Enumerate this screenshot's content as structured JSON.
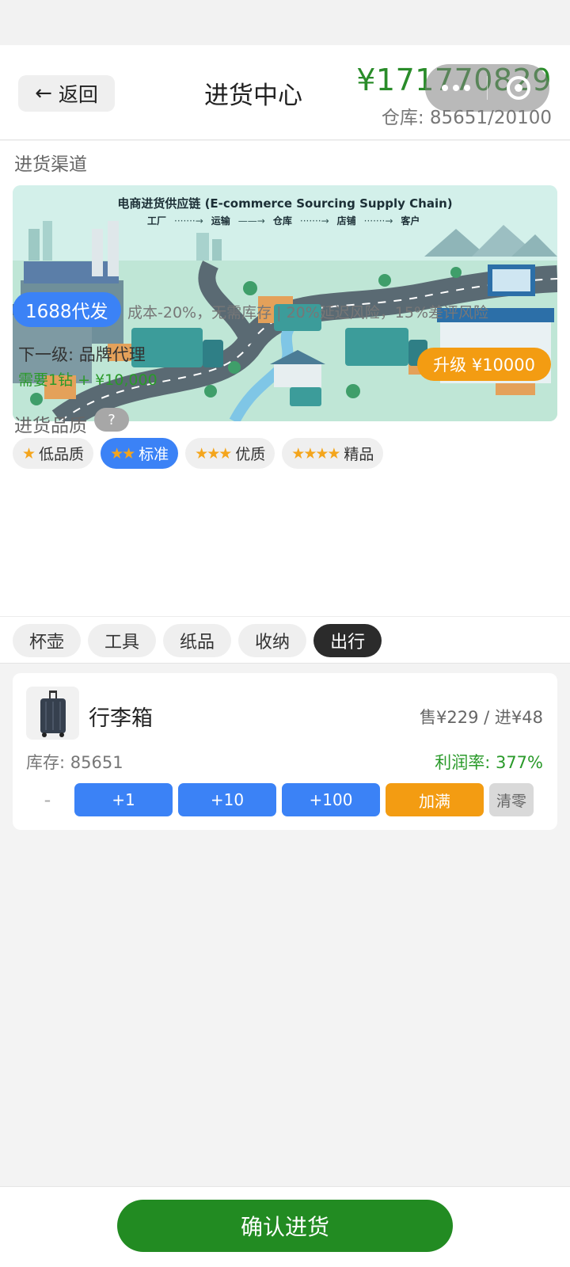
{
  "header": {
    "back_label": "返回",
    "title": "进货中心",
    "money": "¥171770829",
    "warehouse": "仓库: 85651/20100"
  },
  "channel": {
    "section_label": "进货渠道",
    "banner": {
      "title": "电商进货供应链 (E-commerce Sourcing Supply Chain)",
      "steps": [
        "工厂",
        "运输",
        "仓库",
        "店铺",
        "客户"
      ]
    },
    "badge": "1688代发",
    "description": "成本-20%，无需库存 | 20%延迟风险，15%差评风险",
    "next_level": "下一级: 品牌代理",
    "requirement": "需要1钻 + ¥10,000",
    "upgrade_label": "升级 ¥10000"
  },
  "quality": {
    "section_label": "进货品质",
    "help": "?",
    "options": [
      {
        "stars": "★",
        "label": "低品质"
      },
      {
        "stars": "★★",
        "label": "标准"
      },
      {
        "stars": "★★★",
        "label": "优质"
      },
      {
        "stars": "★★★★",
        "label": "精品"
      }
    ],
    "selected_index": 1
  },
  "categories": {
    "tabs": [
      "杯壶",
      "工具",
      "纸品",
      "收纳",
      "出行"
    ],
    "active_index": 4
  },
  "product": {
    "name": "行李箱",
    "price": "售¥229 / 进¥48",
    "stock": "库存: 85651",
    "profit": "利润率: 377%",
    "minus": "-",
    "actions": [
      "+1",
      "+10",
      "+100",
      "加满",
      "清零"
    ]
  },
  "footer": {
    "confirm_label": "确认进货"
  },
  "colors": {
    "accent_blue": "#3b82f6",
    "accent_orange": "#f39c12",
    "money_green": "#2a8c2a",
    "confirm_green": "#228b22"
  }
}
